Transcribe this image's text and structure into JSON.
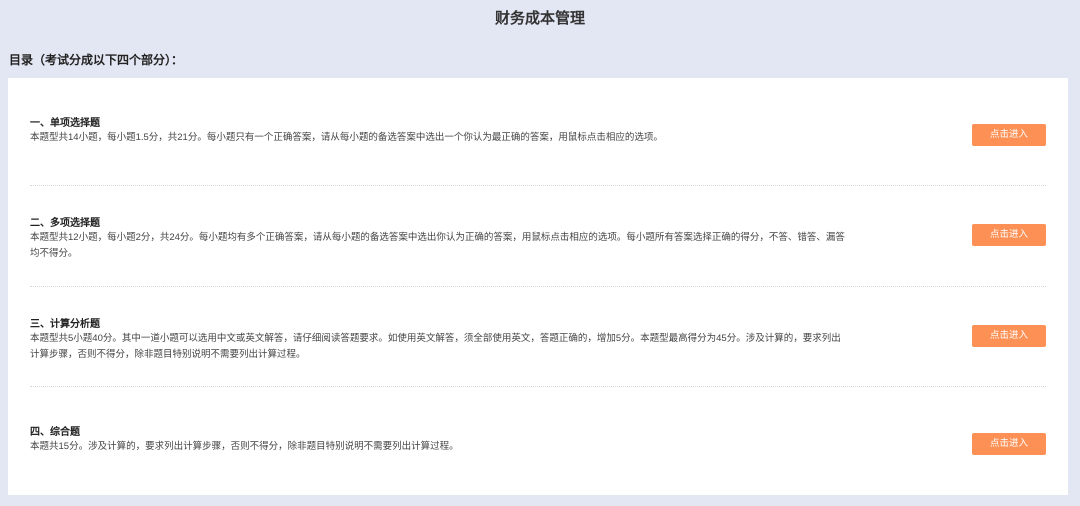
{
  "header": {
    "title": "财务成本管理",
    "toc_label": "目录（考试分成以下四个部分）："
  },
  "sections": [
    {
      "title": "一、单项选择题",
      "desc": "本题型共14小题，每小题1.5分，共21分。每小题只有一个正确答案，请从每小题的备选答案中选出一个你认为最正确的答案，用鼠标点击相应的选项。",
      "button": "点击进入"
    },
    {
      "title": "二、多项选择题",
      "desc": "本题型共12小题，每小题2分，共24分。每小题均有多个正确答案，请从每小题的备选答案中选出你认为正确的答案，用鼠标点击相应的选项。每小题所有答案选择正确的得分，不答、错答、漏答均不得分。",
      "button": "点击进入"
    },
    {
      "title": "三、计算分析题",
      "desc": "本题型共5小题40分。其中一道小题可以选用中文或英文解答，请仔细阅读答题要求。如使用英文解答，须全部使用英文，答题正确的，增加5分。本题型最高得分为45分。涉及计算的，要求列出计算步骤，否则不得分，除非题目特别说明不需要列出计算过程。",
      "button": "点击进入"
    },
    {
      "title": "四、综合题",
      "desc": "本题共15分。涉及计算的，要求列出计算步骤，否则不得分，除非题目特别说明不需要列出计算过程。",
      "button": "点击进入"
    }
  ],
  "colors": {
    "accent": "#fd9155",
    "background": "#e3e7f3"
  }
}
